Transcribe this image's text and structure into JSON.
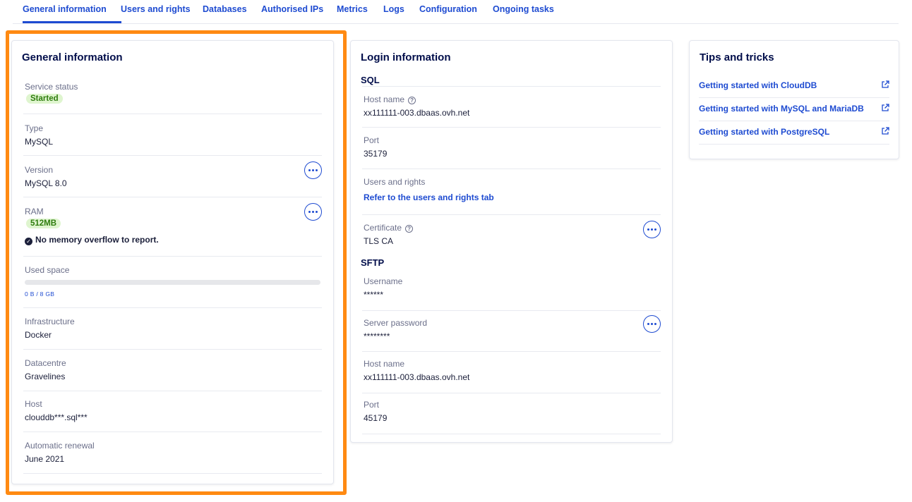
{
  "tabs": [
    {
      "label": "General information"
    },
    {
      "label": "Users and rights"
    },
    {
      "label": "Databases"
    },
    {
      "label": "Authorised IPs"
    },
    {
      "label": "Metrics"
    },
    {
      "label": "Logs"
    },
    {
      "label": "Configuration"
    },
    {
      "label": "Ongoing tasks"
    }
  ],
  "general": {
    "title": "General information",
    "service_status": {
      "label": "Service status",
      "value": "Started"
    },
    "type": {
      "label": "Type",
      "value": "MySQL"
    },
    "version": {
      "label": "Version",
      "value": "MySQL 8.0"
    },
    "ram": {
      "label": "RAM",
      "value": "512MB",
      "note": "No memory overflow to report."
    },
    "used_space": {
      "label": "Used space",
      "value": "0 B / 8 GB",
      "fraction": 0
    },
    "infrastructure": {
      "label": "Infrastructure",
      "value": "Docker"
    },
    "datacentre": {
      "label": "Datacentre",
      "value": "Gravelines"
    },
    "host": {
      "label": "Host",
      "value": "clouddb***.sql***"
    },
    "renewal": {
      "label": "Automatic renewal",
      "value": "June 2021"
    }
  },
  "login": {
    "title": "Login information",
    "sql": {
      "heading": "SQL",
      "host": {
        "label": "Host name",
        "value": "xx111111-003.dbaas.ovh.net"
      },
      "port": {
        "label": "Port",
        "value": "35179"
      },
      "users": {
        "label": "Users and rights",
        "link": "Refer to the users and rights tab"
      },
      "certificate": {
        "label": "Certificate",
        "value": "TLS CA"
      }
    },
    "sftp": {
      "heading": "SFTP",
      "username": {
        "label": "Username",
        "value": "******"
      },
      "password": {
        "label": "Server password",
        "value": "********"
      },
      "host": {
        "label": "Host name",
        "value": "xx111111-003.dbaas.ovh.net"
      },
      "port": {
        "label": "Port",
        "value": "45179"
      }
    }
  },
  "tips": {
    "title": "Tips and tricks",
    "links": [
      {
        "label": "Getting started with CloudDB"
      },
      {
        "label": "Getting started with MySQL and MariaDB"
      },
      {
        "label": "Getting started with PostgreSQL"
      }
    ]
  },
  "colors": {
    "accent": "#1e4bd1",
    "highlight": "#ff8a12",
    "success_bg": "#dff5cf",
    "success_text": "#2f7d0f"
  },
  "icons": {
    "more": "more-horizontal-icon",
    "help": "help-circle-icon",
    "check": "check-circle-icon",
    "external": "external-link-icon"
  }
}
